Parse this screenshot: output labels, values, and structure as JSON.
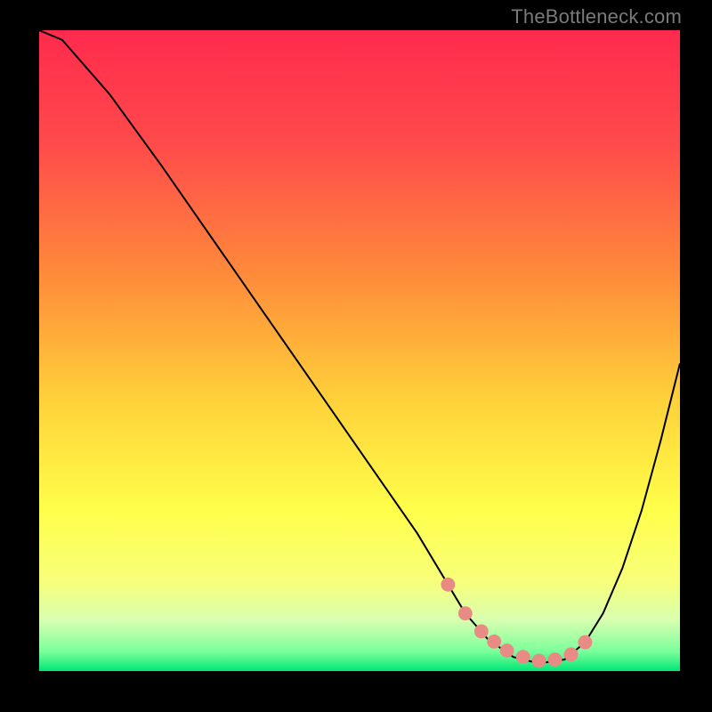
{
  "watermark": "TheBottleneck.com",
  "chart_data": {
    "type": "line",
    "title": "",
    "xlabel": "",
    "ylabel": "",
    "xlim": [
      0,
      100
    ],
    "ylim": [
      0,
      100
    ],
    "grid": false,
    "legend": false,
    "gradient_stops": [
      {
        "offset": 0,
        "color": "#ff2a4d"
      },
      {
        "offset": 18,
        "color": "#ff4b4b"
      },
      {
        "offset": 38,
        "color": "#ff8a3a"
      },
      {
        "offset": 58,
        "color": "#ffd23a"
      },
      {
        "offset": 75,
        "color": "#ffff4a"
      },
      {
        "offset": 86,
        "color": "#f7ff7a"
      },
      {
        "offset": 92,
        "color": "#d9ffb0"
      },
      {
        "offset": 97,
        "color": "#7aff9a"
      },
      {
        "offset": 100,
        "color": "#00e676"
      }
    ],
    "series": [
      {
        "name": "curve",
        "x": [
          0,
          3.6,
          11,
          19,
          27,
          35,
          43,
          51,
          59,
          63.8,
          66.5,
          70,
          74,
          78,
          82,
          85.2,
          88,
          91,
          94,
          97,
          100
        ],
        "y": [
          100,
          98.5,
          90,
          79,
          67.5,
          56,
          44.5,
          33,
          21.5,
          13.5,
          9,
          5,
          2.2,
          1.2,
          1.8,
          4.5,
          9,
          16,
          25,
          36,
          48
        ]
      }
    ],
    "markers": {
      "name": "highlight-points",
      "color": "#e88b84",
      "x": [
        63.8,
        66.5,
        69,
        71,
        73,
        75.5,
        78,
        80.5,
        83,
        85.2
      ],
      "y": [
        13.5,
        9,
        6.2,
        4.6,
        3.2,
        2.2,
        1.6,
        1.8,
        2.6,
        4.5
      ],
      "r": 1.1
    }
  }
}
